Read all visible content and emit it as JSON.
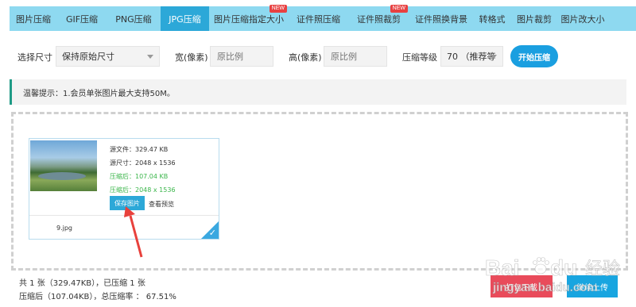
{
  "tabs": [
    {
      "label": "图片压缩",
      "new": false,
      "active": false
    },
    {
      "label": "GIF压缩",
      "new": false,
      "active": false
    },
    {
      "label": "PNG压缩",
      "new": false,
      "active": false
    },
    {
      "label": "JPG压缩",
      "new": false,
      "active": true
    },
    {
      "label": "图片压缩指定大小",
      "new": true,
      "active": false
    },
    {
      "label": "证件照压缩",
      "new": false,
      "active": false
    },
    {
      "label": "证件照裁剪",
      "new": true,
      "active": false
    },
    {
      "label": "证件照换背景",
      "new": false,
      "active": false
    },
    {
      "label": "转格式",
      "new": false,
      "active": false
    },
    {
      "label": "图片裁剪",
      "new": false,
      "active": false
    },
    {
      "label": "图片改大小",
      "new": false,
      "active": false
    }
  ],
  "badge": "NEW",
  "options": {
    "size_label": "选择尺寸",
    "size_value": "保持原始尺寸",
    "width_label": "宽(像素)",
    "width_placeholder": "原比例",
    "height_label": "高(像素)",
    "height_placeholder": "原比例",
    "level_label": "压缩等级",
    "level_value": "70 （推荐等",
    "start_button": "开始压缩"
  },
  "notice": "温馨提示：1.会员单张图片最大支持50M。",
  "file": {
    "source_size": "源文件：329.47 KB",
    "source_dims": "源尺寸：2048 x 1536",
    "compressed_size": "压缩后：107.04 KB",
    "compressed_dims": "压缩后：2048 x 1536",
    "save_button": "保存图片",
    "preview_link": "查看预览",
    "name": "9.jpg",
    "checkmark": "✓"
  },
  "summary": {
    "line1": "共 1 张（329.47KB），已压缩 1 张",
    "line2": "压缩后（107.04KB），总压缩率 ： 67.51%"
  },
  "footer_buttons": {
    "zip": "打包下载",
    "upload": "继续上传"
  },
  "watermark": {
    "brand": "Bai",
    "paw": "du",
    "product": "经验",
    "url": "jingyan.baidu.com"
  },
  "colors": {
    "tab_bar": "#8ed9f0",
    "tab_active": "#2ca8d8",
    "new_badge": "#e84141",
    "primary_button": "#1a9fe0",
    "notice_accent": "#1f9b86",
    "compressed_text": "#3bb64b",
    "zip_button": "#e94b5b",
    "annotation_arrow": "#e8413c"
  }
}
